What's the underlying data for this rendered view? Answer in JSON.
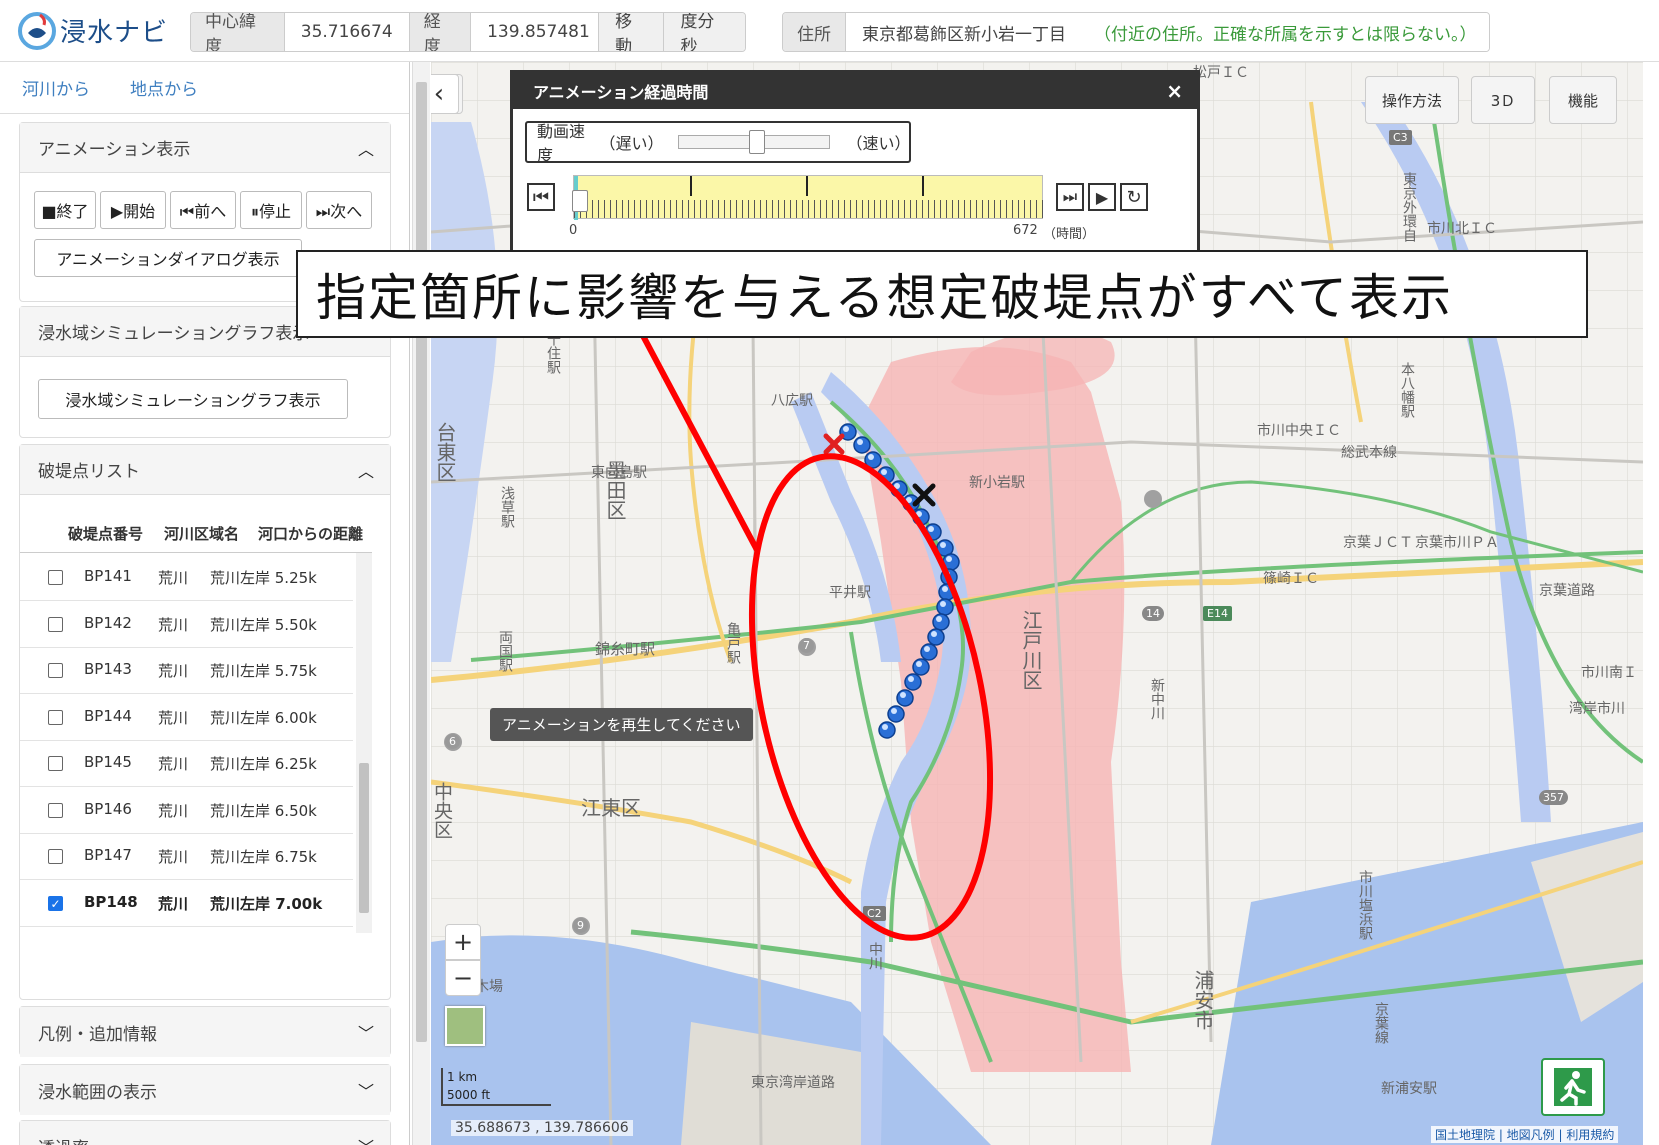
{
  "app": {
    "logo_text": "浸水ナビ"
  },
  "header": {
    "center_lat_label": "中心緯度",
    "center_lat_value": "35.716674",
    "lon_label": "経度",
    "lon_value": "139.857481",
    "move_button": "移動",
    "dms_button": "度分秒",
    "address_label": "住所",
    "address_value": "東京都葛飾区新小岩一丁目",
    "address_note": "（付近の住所。正確な所属を示すとは限らない。）"
  },
  "left_tabs": [
    "河川から",
    "地点から"
  ],
  "animation_section": {
    "title": "アニメーション表示",
    "buttons": [
      "■終了",
      "▶開始",
      "⏮前へ",
      "⏸停止",
      "⏭次へ"
    ],
    "dialog_button": "アニメーションダイアログ表示"
  },
  "graph_section": {
    "title": "浸水域シミュレーショングラフ表示",
    "button": "浸水域シミュレーショングラフ表示"
  },
  "breach_section": {
    "title": "破堤点リスト",
    "columns": [
      "破堤点番号",
      "河川区域名",
      "河口からの距離"
    ],
    "rows": [
      {
        "id": "BP141",
        "river": "荒川",
        "distance": "荒川左岸 5.25k",
        "checked": false
      },
      {
        "id": "BP142",
        "river": "荒川",
        "distance": "荒川左岸 5.50k",
        "checked": false
      },
      {
        "id": "BP143",
        "river": "荒川",
        "distance": "荒川左岸 5.75k",
        "checked": false
      },
      {
        "id": "BP144",
        "river": "荒川",
        "distance": "荒川左岸 6.00k",
        "checked": false
      },
      {
        "id": "BP145",
        "river": "荒川",
        "distance": "荒川左岸 6.25k",
        "checked": false
      },
      {
        "id": "BP146",
        "river": "荒川",
        "distance": "荒川左岸 6.50k",
        "checked": false
      },
      {
        "id": "BP147",
        "river": "荒川",
        "distance": "荒川左岸 6.75k",
        "checked": false
      },
      {
        "id": "BP148",
        "river": "荒川",
        "distance": "荒川左岸 7.00k",
        "checked": true
      }
    ]
  },
  "collapsed_sections": [
    "凡例・追加情報",
    "浸水範囲の表示",
    "透過率"
  ],
  "map_buttons": {
    "howto": "操作方法",
    "three_d": "3Ｄ",
    "functions": "機能",
    "zoom_in": "+",
    "zoom_out": "−"
  },
  "anim_dialog": {
    "title": "アニメーション経過時間",
    "speed_label": "動画速度",
    "slow_label": "（遅い）",
    "fast_label": "（速い）",
    "speed_level": 0.5,
    "time_start": "0",
    "time_end": "672",
    "time_unit": "（時間）",
    "close": "×"
  },
  "callout": "指定箇所に影響を与える想定破堤点がすべて表示",
  "tooltip": "アニメーションを再生してください",
  "scale": {
    "km": "1 km",
    "ft": "5000 ft"
  },
  "cursor_coords": "35.688673 , 139.786606",
  "attribution": "国土地理院 | 地図凡例 | 利用規約",
  "map_labels": {
    "taito": "台東区",
    "sumida": "墨田区",
    "koto": "江東区",
    "edogawa": "江戸川区",
    "chuo": "中央区",
    "urayasu": "浦安市",
    "ichikawa_shiohama": "市川塩浜駅",
    "kinshicho": "錦糸町駅",
    "hirai": "平井駅",
    "yahiro": "八広駅",
    "higashi_mukojima": "東向島駅",
    "shinkoiwa": "新小岩駅",
    "ichikawa_chuo": "市川中央ＩＣ",
    "ichikawa_kita": "市川北ＩＣ",
    "shinozaki": "篠崎ＩＣ",
    "keiyo_jct": "京葉ＪＣＴ",
    "keiyo_ichikawa": "京葉市川ＰＡ",
    "keiyo_road": "京葉道路",
    "tokyo_wangan": "東京湾岸道路",
    "shin_urayasu": "新浦安駅",
    "ichikawa_minami": "市川南Ｉ",
    "wangan_ichikawa": "湾岸市川",
    "shin_nakagawa": "新中川",
    "matsudo": "松戸ＩＣ",
    "sobu": "総武本線",
    "kameido": "亀戸駅",
    "ryogoku": "両国駅",
    "asakusa": "浅草駅",
    "minami_senju": "南千住駅",
    "shin_kiba": "新木場",
    "c2": "C2",
    "c3": "C3",
    "e14": "E14",
    "r14": "14",
    "r7": "7",
    "r6": "6",
    "r9": "9",
    "r357": "357",
    "nakagawa": "中川",
    "keiyo_line": "京葉線",
    "motoyawata": "本八幡駅",
    "gaikan": "東京外環自"
  },
  "colors": {
    "flood": "#f6b4b4",
    "river": "#b9cbf2",
    "highlight": "#ff0000",
    "road_green": "#72c27a",
    "road_yellow": "#f5d37a",
    "sea": "#a9c3ee"
  }
}
